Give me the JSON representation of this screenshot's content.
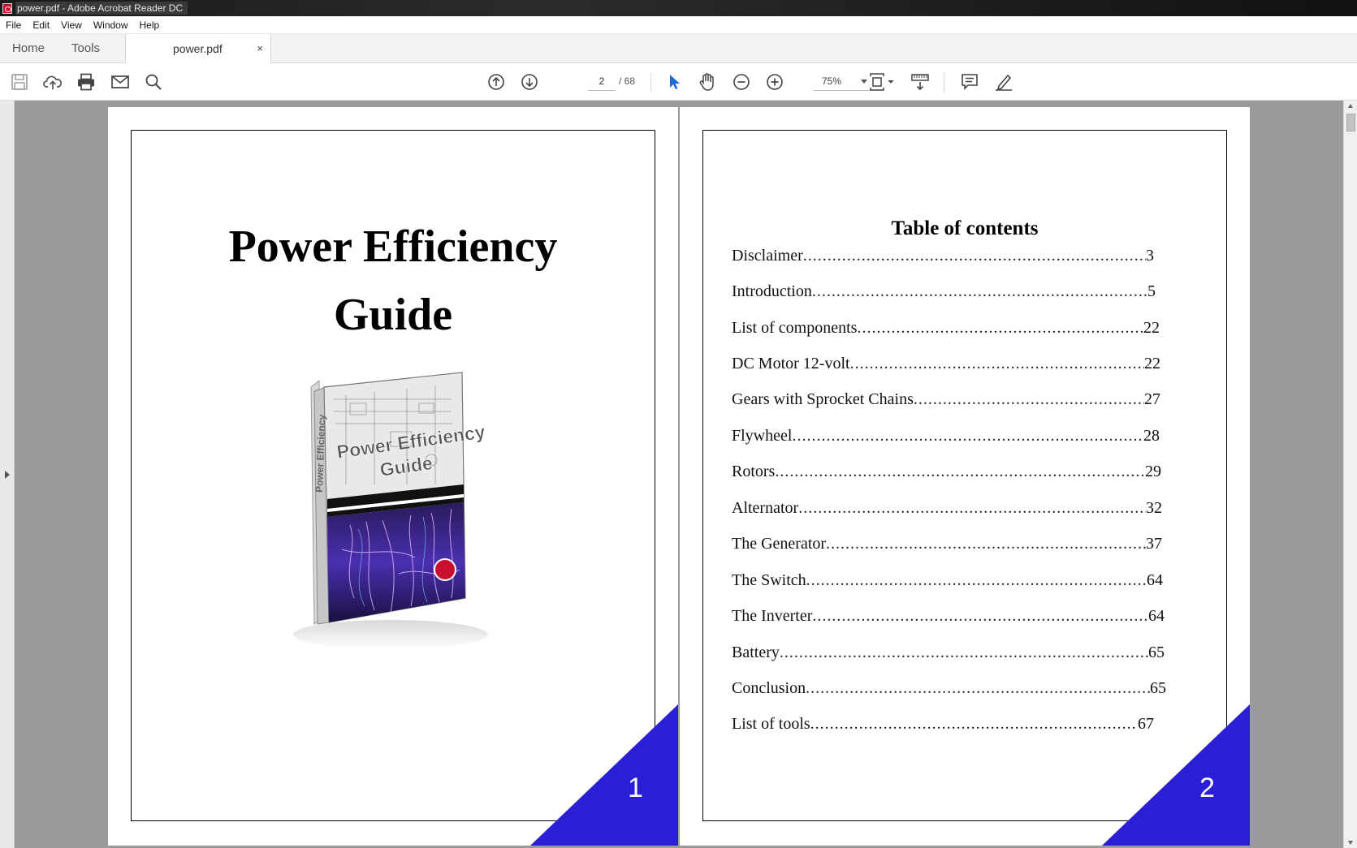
{
  "window": {
    "title": "power.pdf - Adobe Acrobat Reader DC"
  },
  "menu": {
    "items": [
      "File",
      "Edit",
      "View",
      "Window",
      "Help"
    ]
  },
  "tabs": {
    "home": "Home",
    "tools": "Tools",
    "document": "power.pdf",
    "close": "×"
  },
  "toolbar": {
    "current_page": "2",
    "total_pages": "/ 68",
    "zoom": "75%",
    "icons": [
      "save-icon",
      "cloud-upload-icon",
      "print-icon",
      "email-icon",
      "search-icon",
      "previous-page-icon",
      "next-page-icon",
      "select-arrow-icon",
      "hand-icon",
      "zoom-out-icon",
      "zoom-in-icon",
      "fit-page-icon",
      "scroll-mode-icon",
      "comment-icon",
      "sign-icon"
    ]
  },
  "document": {
    "page1": {
      "title_line1": "Power Efficiency",
      "title_line2": "Guide",
      "book_title_line1": "Power Efficiency",
      "book_title_line2": "Guide",
      "book_spine": "Power Efficiency",
      "page_number": "1"
    },
    "page2": {
      "heading": "Table of contents",
      "entries": [
        {
          "label": "Disclaimer",
          "page": "3"
        },
        {
          "label": "Introduction",
          "page": "5"
        },
        {
          "label": "List of components",
          "page": "22"
        },
        {
          "label": "DC Motor 12-volt",
          "page": "22"
        },
        {
          "label": "Gears with Sprocket Chains",
          "page": "27"
        },
        {
          "label": "Flywheel",
          "page": "28"
        },
        {
          "label": "Rotors",
          "page": "29"
        },
        {
          "label": "Alternator",
          "page": "32"
        },
        {
          "label": "The Generator",
          "page": "37"
        },
        {
          "label": "The Switch",
          "page": "64"
        },
        {
          "label": "The Inverter",
          "page": "64"
        },
        {
          "label": "Battery",
          "page": "65"
        },
        {
          "label": "Conclusion",
          "page": "65"
        },
        {
          "label": "List of tools",
          "page": "67"
        }
      ],
      "page_number": "2"
    }
  },
  "colors": {
    "accent_triangle": "#2b1fd6",
    "viewer_background": "#9a9a9a"
  }
}
